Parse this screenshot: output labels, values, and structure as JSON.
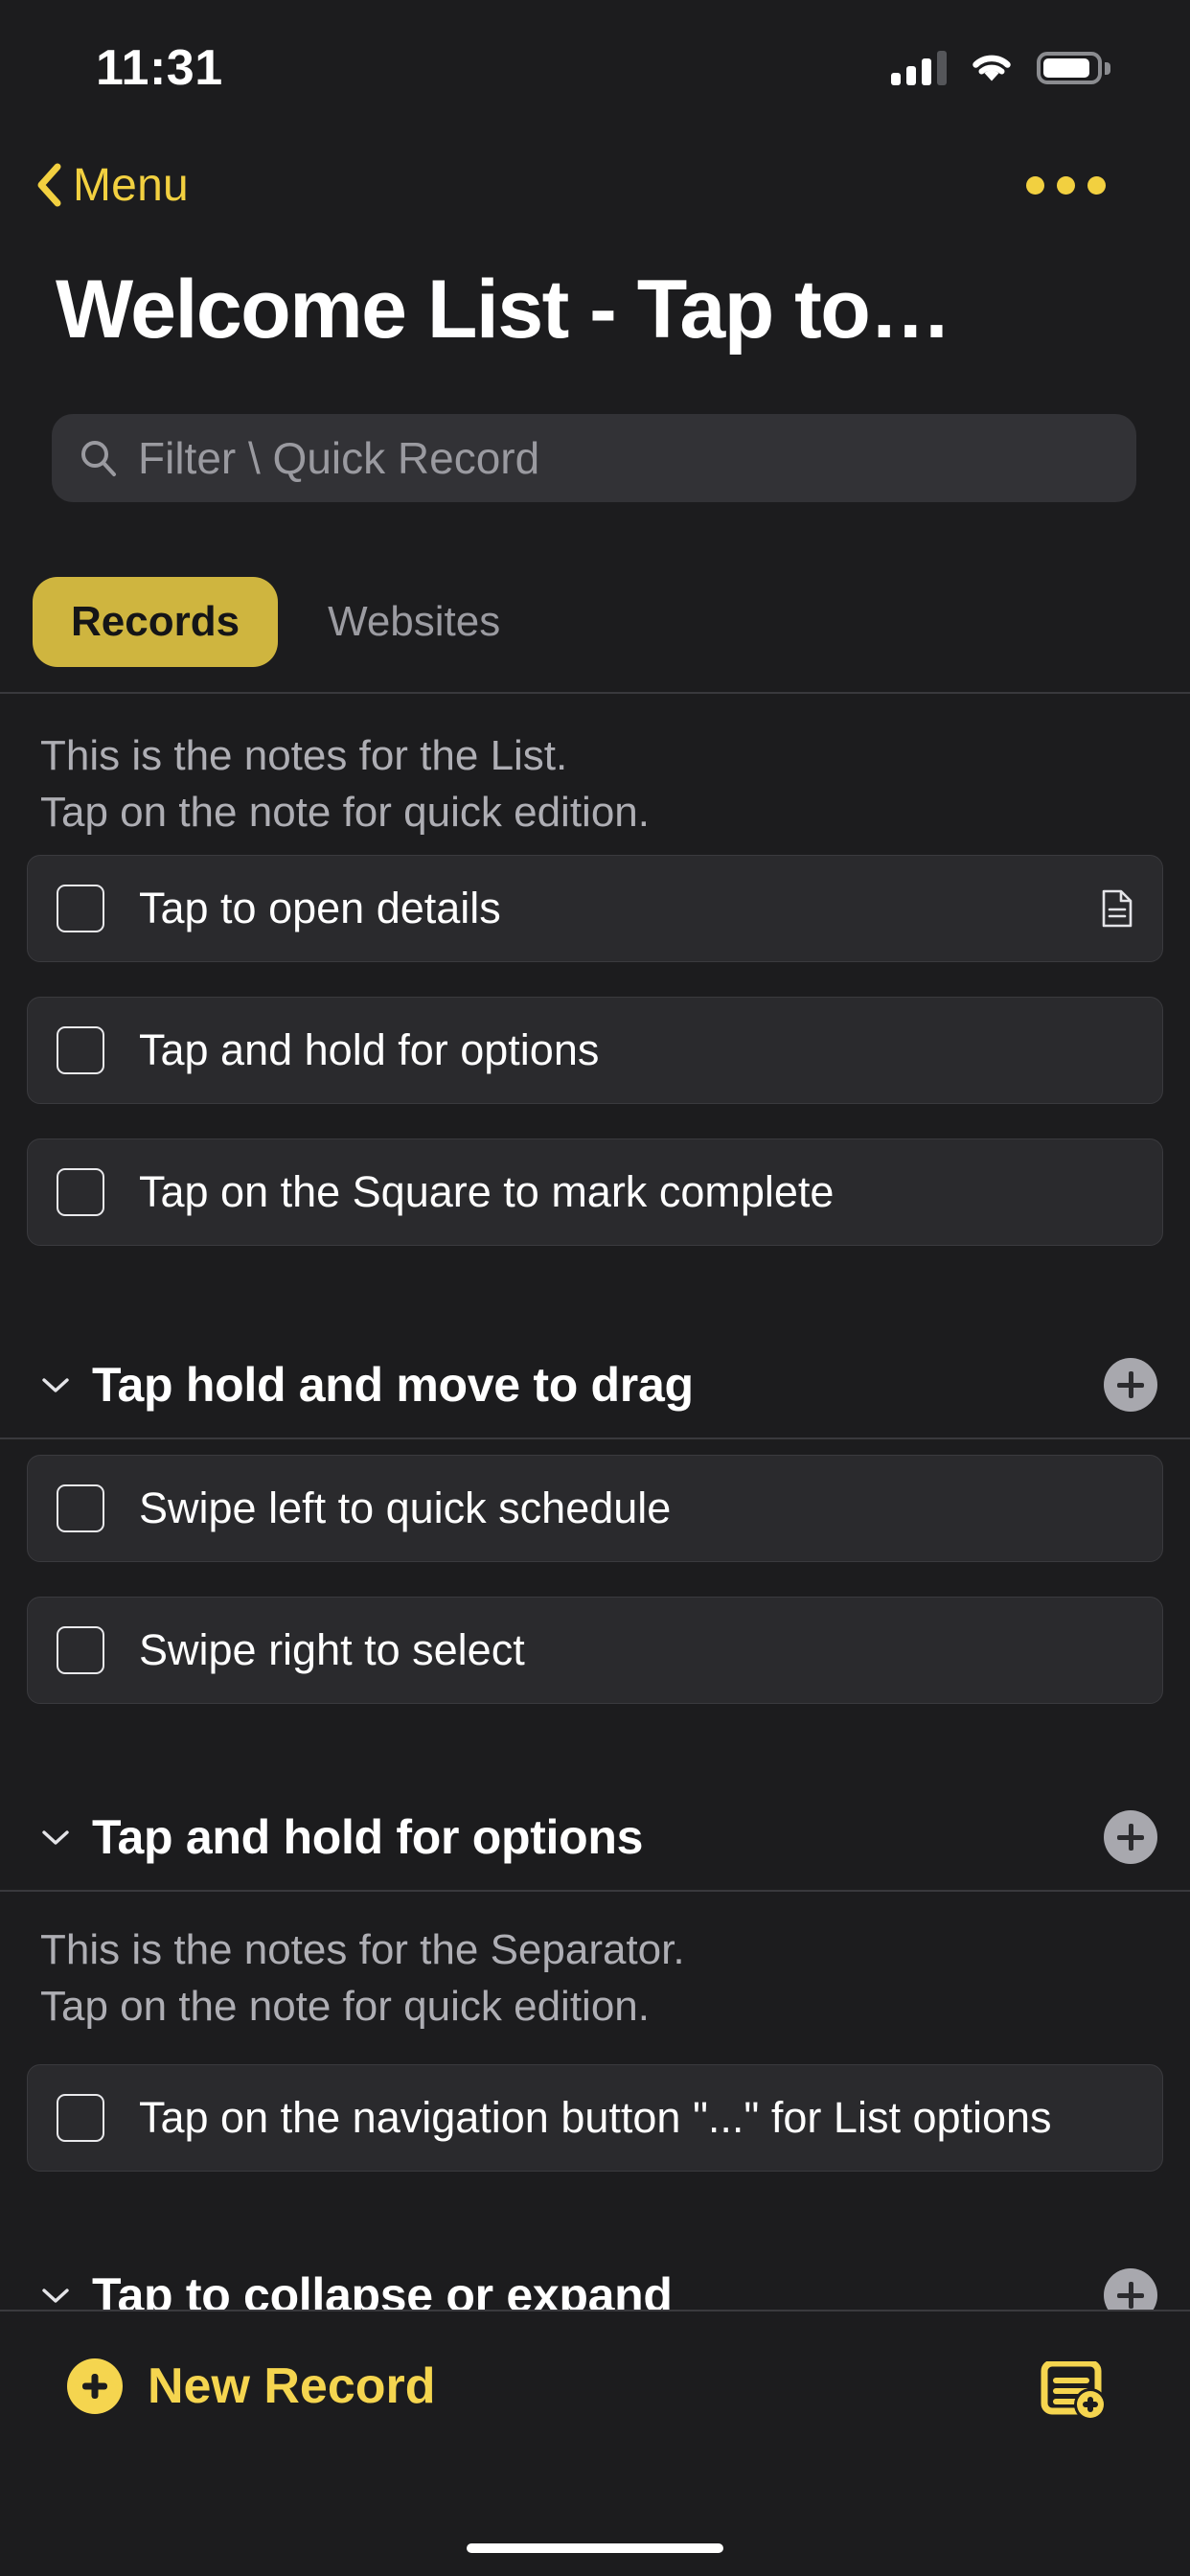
{
  "status_bar": {
    "time": "11:31",
    "cellular_icon": "cellular-signal-icon",
    "wifi_icon": "wifi-icon",
    "battery_icon": "battery-icon"
  },
  "nav_bar": {
    "back_label": "Menu",
    "back_icon": "chevron-left-icon",
    "more_icon": "ellipsis-icon"
  },
  "header": {
    "title": "Welcome List - Tap to…"
  },
  "search": {
    "placeholder": "Filter \\ Quick Record",
    "icon": "search-icon",
    "value": ""
  },
  "tabs": [
    {
      "label": "Records",
      "active": true
    },
    {
      "label": "Websites",
      "active": false
    }
  ],
  "list_notes": {
    "line1": "This is the notes for the List.",
    "line2": "Tap on the note for quick edition."
  },
  "records_group_1": [
    {
      "label": "Tap to open details",
      "checked": false,
      "trailing_icon": "document-icon"
    },
    {
      "label": "Tap and hold for options",
      "checked": false,
      "trailing_icon": ""
    },
    {
      "label": "Tap on the Square to mark complete",
      "checked": false,
      "trailing_icon": ""
    }
  ],
  "section_1": {
    "title": "Tap hold and move to drag",
    "collapse_icon": "chevron-down-icon",
    "add_icon": "plus-circle-icon"
  },
  "records_group_2": [
    {
      "label": "Swipe left to quick schedule",
      "checked": false,
      "trailing_icon": ""
    },
    {
      "label": "Swipe right to select",
      "checked": false,
      "trailing_icon": ""
    }
  ],
  "section_2": {
    "title": "Tap and hold for options",
    "collapse_icon": "chevron-down-icon",
    "add_icon": "plus-circle-icon"
  },
  "separator_notes": {
    "line1": "This is the notes for the Separator.",
    "line2": "Tap on the note for quick edition."
  },
  "records_group_3": [
    {
      "label": "Tap on the navigation button \"...\" for List options",
      "checked": false,
      "trailing_icon": ""
    }
  ],
  "section_3": {
    "title": "Tap to collapse or expand",
    "collapse_icon": "chevron-down-icon",
    "add_icon": "plus-circle-icon"
  },
  "toolbar": {
    "new_record_label": "New Record",
    "new_record_icon": "plus-circle-filled-icon",
    "add_note_icon": "note-add-icon"
  },
  "colors": {
    "background": "#1c1c1e",
    "card": "#2a2a2d",
    "accent_yellow": "#f2d040",
    "tab_active": "#cfb53f",
    "muted_text": "#9a9aa0",
    "search_field": "#323236"
  }
}
